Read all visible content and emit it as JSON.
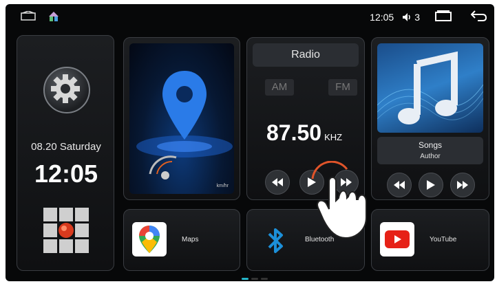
{
  "status": {
    "time": "12:05",
    "volume": "3"
  },
  "clock": {
    "date": "08.20 Saturday",
    "time": "12:05"
  },
  "nav": {
    "speed_unit": "km/hr"
  },
  "radio": {
    "title": "Radio",
    "am_label": "AM",
    "fm_label": "FM",
    "frequency": "87.50",
    "unit": "KHZ"
  },
  "music": {
    "title": "Songs",
    "author": "Author"
  },
  "apps": [
    {
      "label": "Maps",
      "icon": "google-maps-icon"
    },
    {
      "label": "Bluetooth",
      "icon": "bluetooth-icon"
    },
    {
      "label": "YouTube",
      "icon": "youtube-icon"
    }
  ],
  "colors": {
    "accent": "#24b5c8",
    "youtube": "#e62117",
    "bluetooth": "#1c8fd8",
    "touch_ring": "#e0542a"
  }
}
